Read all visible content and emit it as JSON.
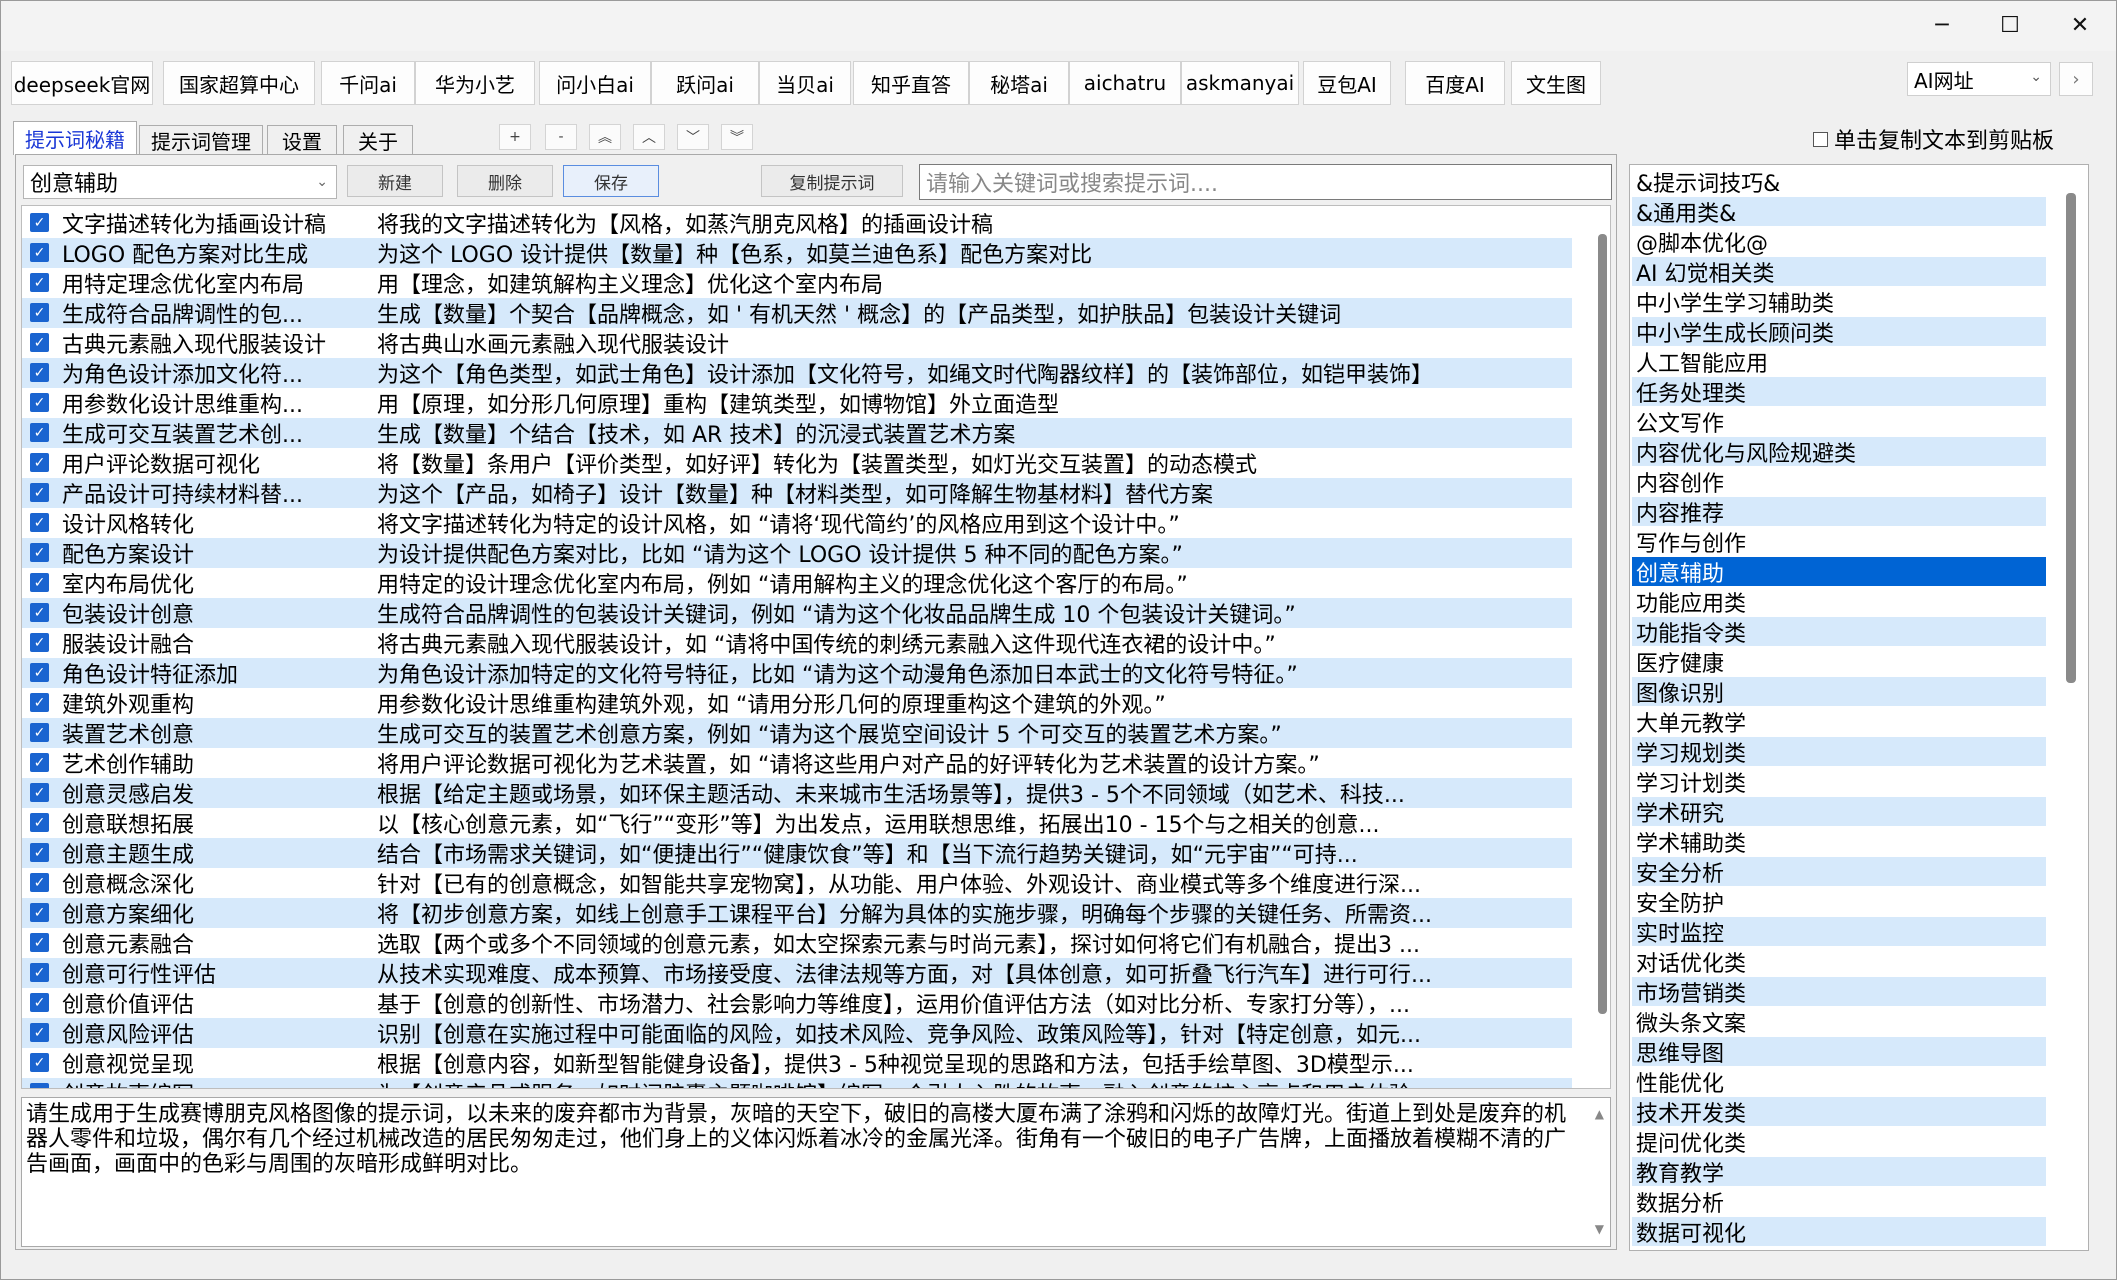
{
  "window": {
    "minimize": "─",
    "maximize": "☐",
    "close": "✕"
  },
  "sites": [
    "deepseek官网",
    "国家超算中心",
    "千问ai",
    "华为小艺",
    "问小白ai",
    "跃问ai",
    "当贝ai",
    "知乎直答",
    "秘塔ai",
    "aichatru",
    "askmanyai",
    "豆包AI",
    "百度AI",
    "文生图"
  ],
  "ai_select": {
    "value": "AI网址",
    "arrow": "⌄",
    "go": "›"
  },
  "tabs": [
    "提示词秘籍",
    "提示词管理",
    "设置",
    "关于"
  ],
  "order_buttons": [
    "+",
    "-",
    "︽",
    "︿",
    "﹀",
    "︾"
  ],
  "copy_option": "单击复制文本到剪贴板",
  "toolbar": {
    "category_value": "创意辅助",
    "new": "新建",
    "delete": "删除",
    "save": "保存",
    "copy_prompt": "复制提示词",
    "search_placeholder": "请输入关键词或搜索提示词...."
  },
  "prompts": [
    {
      "name": "文字描述转化为插画设计稿",
      "content": "将我的文字描述转化为【风格，如蒸汽朋克风格】的插画设计稿"
    },
    {
      "name": "LOGO 配色方案对比生成",
      "content": "为这个 LOGO 设计提供【数量】种【色系，如莫兰迪色系】配色方案对比"
    },
    {
      "name": "用特定理念优化室内布局",
      "content": "用【理念，如建筑解构主义理念】优化这个室内布局"
    },
    {
      "name": "生成符合品牌调性的包...",
      "content": "生成【数量】个契合【品牌概念，如 ' 有机天然 ' 概念】的【产品类型，如护肤品】包装设计关键词"
    },
    {
      "name": "古典元素融入现代服装设计",
      "content": "将古典山水画元素融入现代服装设计"
    },
    {
      "name": "为角色设计添加文化符...",
      "content": "为这个【角色类型，如武士角色】设计添加【文化符号，如绳文时代陶器纹样】的【装饰部位，如铠甲装饰】"
    },
    {
      "name": "用参数化设计思维重构...",
      "content": "用【原理，如分形几何原理】重构【建筑类型，如博物馆】外立面造型"
    },
    {
      "name": "生成可交互装置艺术创...",
      "content": "生成【数量】个结合【技术，如 AR 技术】的沉浸式装置艺术方案"
    },
    {
      "name": "用户评论数据可视化",
      "content": "将【数量】条用户【评价类型，如好评】转化为【装置类型，如灯光交互装置】的动态模式"
    },
    {
      "name": "产品设计可持续材料替...",
      "content": "为这个【产品，如椅子】设计【数量】种【材料类型，如可降解生物基材料】替代方案"
    },
    {
      "name": "设计风格转化",
      "content": "将文字描述转化为特定的设计风格，如 “请将‘现代简约’的风格应用到这个设计中。”"
    },
    {
      "name": "配色方案设计",
      "content": "为设计提供配色方案对比，比如 “请为这个 LOGO 设计提供 5 种不同的配色方案。”"
    },
    {
      "name": "室内布局优化",
      "content": "用特定的设计理念优化室内布局，例如 “请用解构主义的理念优化这个客厅的布局。”"
    },
    {
      "name": "包装设计创意",
      "content": "生成符合品牌调性的包装设计关键词，例如 “请为这个化妆品品牌生成 10 个包装设计关键词。”"
    },
    {
      "name": "服装设计融合",
      "content": "将古典元素融入现代服装设计，如 “请将中国传统的刺绣元素融入这件现代连衣裙的设计中。”"
    },
    {
      "name": "角色设计特征添加",
      "content": "为角色设计添加特定的文化符号特征，比如 “请为这个动漫角色添加日本武士的文化符号特征。”"
    },
    {
      "name": "建筑外观重构",
      "content": "用参数化设计思维重构建筑外观，如 “请用分形几何的原理重构这个建筑的外观。”"
    },
    {
      "name": "装置艺术创意",
      "content": "生成可交互的装置艺术创意方案，例如 “请为这个展览空间设计 5 个可交互的装置艺术方案。”"
    },
    {
      "name": "艺术创作辅助",
      "content": "将用户评论数据可视化为艺术装置，如 “请将这些用户对产品的好评转化为艺术装置的设计方案。”"
    },
    {
      "name": "创意灵感启发",
      "content": "根据【给定主题或场景，如环保主题活动、未来城市生活场景等】，提供3 - 5个不同领域（如艺术、科技..."
    },
    {
      "name": "创意联想拓展",
      "content": "以【核心创意元素，如“飞行”“变形”等】为出发点，运用联想思维，拓展出10 - 15个与之相关的创意..."
    },
    {
      "name": "创意主题生成",
      "content": "结合【市场需求关键词，如“便捷出行”“健康饮食”等】和【当下流行趋势关键词，如“元宇宙”“可持..."
    },
    {
      "name": "创意概念深化",
      "content": "针对【已有的创意概念，如智能共享宠物窝】，从功能、用户体验、外观设计、商业模式等多个维度进行深..."
    },
    {
      "name": "创意方案细化",
      "content": "将【初步创意方案，如线上创意手工课程平台】分解为具体的实施步骤，明确每个步骤的关键任务、所需资..."
    },
    {
      "name": "创意元素融合",
      "content": "选取【两个或多个不同领域的创意元素，如太空探索元素与时尚元素】，探讨如何将它们有机融合，提出3 ..."
    },
    {
      "name": "创意可行性评估",
      "content": "从技术实现难度、成本预算、市场接受度、法律法规等方面，对【具体创意，如可折叠飞行汽车】进行可行..."
    },
    {
      "name": "创意价值评估",
      "content": "基于【创意的创新性、市场潜力、社会影响力等维度】，运用价值评估方法（如对比分析、专家打分等），..."
    },
    {
      "name": "创意风险评估",
      "content": "识别【创意在实施过程中可能面临的风险，如技术风险、竞争风险、政策风险等】，针对【特定创意，如元..."
    },
    {
      "name": "创意视觉呈现",
      "content": "根据【创意内容，如新型智能健身设备】，提供3 - 5种视觉呈现的思路和方法，包括手绘草图、3D模型示..."
    },
    {
      "name": "创意故事编写",
      "content": "为【创意产品或服务，如时间胶囊主题咖啡馆】编写一个引人入胜的故事，融入创意的核心亮点和用户体验..."
    }
  ],
  "editor_text": "请生成用于生成赛博朋克风格图像的提示词，以未来的废弃都市为背景，灰暗的天空下，破旧的高楼大厦布满了涂鸦和闪烁的故障灯光。街道上到处是废弃的机器人零件和垃圾，偶尔有几个经过机械改造的居民匆匆走过，他们身上的义体闪烁着冰冷的金属光泽。街角有一个破旧的电子广告牌，上面播放着模糊不清的广告画面，画面中的色彩与周围的灰暗形成鲜明对比。",
  "categories": [
    "&提示词技巧&",
    "&通用类&",
    "@脚本优化@",
    "AI 幻觉相关类",
    "中小学生学习辅助类",
    "中小学生成长顾问类",
    "人工智能应用",
    "任务处理类",
    "公文写作",
    "内容优化与风险规避类",
    "内容创作",
    "内容推荐",
    "写作与创作",
    "创意辅助",
    "功能应用类",
    "功能指令类",
    "医疗健康",
    "图像识别",
    "大单元教学",
    "学习规划类",
    "学习计划类",
    "学术研究",
    "学术辅助类",
    "安全分析",
    "安全防护",
    "实时监控",
    "对话优化类",
    "市场营销类",
    "微头条文案",
    "思维导图",
    "性能优化",
    "技术开发类",
    "提问优化类",
    "教育教学",
    "数据分析",
    "数据可视化"
  ],
  "selected_category": "创意辅助",
  "colors": {
    "row_alt": "#d6e9fb",
    "selection": "#0064d4",
    "checkbox": "#1a64d0",
    "active_tab_text": "#1a37d6"
  }
}
